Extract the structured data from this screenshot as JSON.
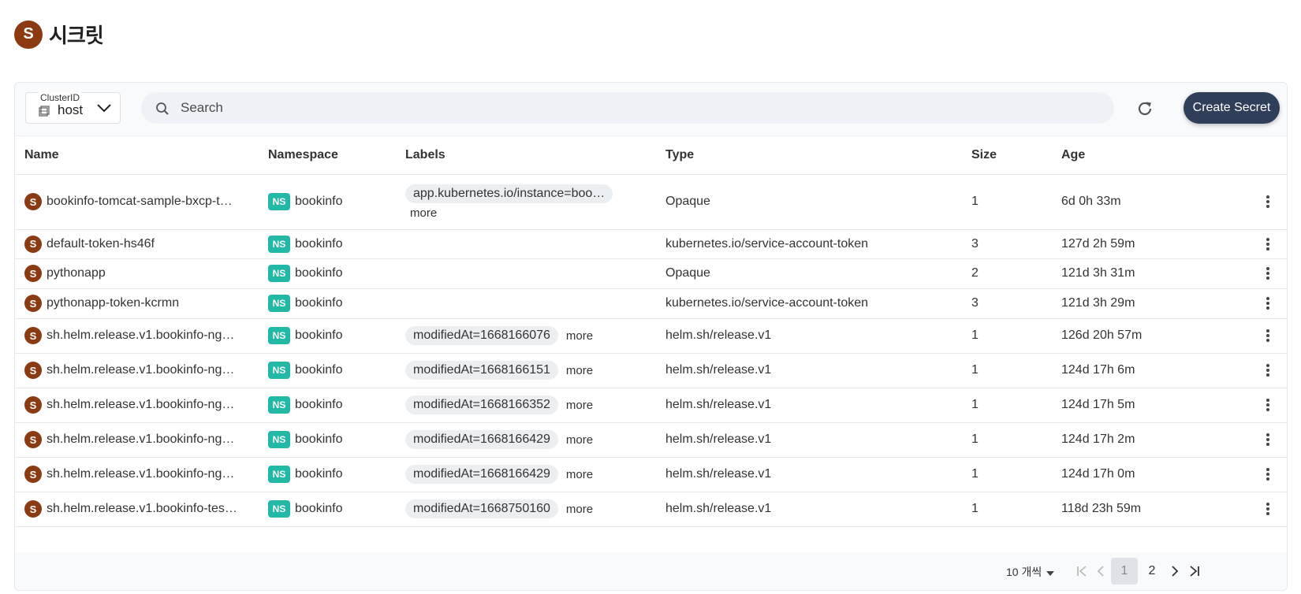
{
  "header": {
    "avatar_letter": "S",
    "title": "시크릿"
  },
  "toolbar": {
    "cluster_label": "ClusterID",
    "cluster_value": "host",
    "search_placeholder": "Search",
    "create_label": "Create Secret"
  },
  "table": {
    "columns": [
      "Name",
      "Namespace",
      "Labels",
      "Type",
      "Size",
      "Age"
    ],
    "rows": [
      {
        "avatar": "S",
        "name": "bookinfo-tomcat-sample-bxcp-t…",
        "ns_badge": "NS",
        "namespace": "bookinfo",
        "label": "app.kubernetes.io/instance=boo…",
        "more": "more",
        "type": "Opaque",
        "size": "1",
        "age": "6d 0h 33m"
      },
      {
        "avatar": "S",
        "name": "default-token-hs46f",
        "ns_badge": "NS",
        "namespace": "bookinfo",
        "label": "",
        "more": "",
        "type": "kubernetes.io/service-account-token",
        "size": "3",
        "age": "127d 2h 59m"
      },
      {
        "avatar": "S",
        "name": "pythonapp",
        "ns_badge": "NS",
        "namespace": "bookinfo",
        "label": "",
        "more": "",
        "type": "Opaque",
        "size": "2",
        "age": "121d 3h 31m"
      },
      {
        "avatar": "S",
        "name": "pythonapp-token-kcrmn",
        "ns_badge": "NS",
        "namespace": "bookinfo",
        "label": "",
        "more": "",
        "type": "kubernetes.io/service-account-token",
        "size": "3",
        "age": "121d 3h 29m"
      },
      {
        "avatar": "S",
        "name": "sh.helm.release.v1.bookinfo-ng…",
        "ns_badge": "NS",
        "namespace": "bookinfo",
        "label": "modifiedAt=1668166076",
        "more": "more",
        "type": "helm.sh/release.v1",
        "size": "1",
        "age": "126d 20h 57m"
      },
      {
        "avatar": "S",
        "name": "sh.helm.release.v1.bookinfo-ng…",
        "ns_badge": "NS",
        "namespace": "bookinfo",
        "label": "modifiedAt=1668166151",
        "more": "more",
        "type": "helm.sh/release.v1",
        "size": "1",
        "age": "124d 17h 6m"
      },
      {
        "avatar": "S",
        "name": "sh.helm.release.v1.bookinfo-ng…",
        "ns_badge": "NS",
        "namespace": "bookinfo",
        "label": "modifiedAt=1668166352",
        "more": "more",
        "type": "helm.sh/release.v1",
        "size": "1",
        "age": "124d 17h 5m"
      },
      {
        "avatar": "S",
        "name": "sh.helm.release.v1.bookinfo-ng…",
        "ns_badge": "NS",
        "namespace": "bookinfo",
        "label": "modifiedAt=1668166429",
        "more": "more",
        "type": "helm.sh/release.v1",
        "size": "1",
        "age": "124d 17h 2m"
      },
      {
        "avatar": "S",
        "name": "sh.helm.release.v1.bookinfo-ng…",
        "ns_badge": "NS",
        "namespace": "bookinfo",
        "label": "modifiedAt=1668166429",
        "more": "more",
        "type": "helm.sh/release.v1",
        "size": "1",
        "age": "124d 17h 0m"
      },
      {
        "avatar": "S",
        "name": "sh.helm.release.v1.bookinfo-tes…",
        "ns_badge": "NS",
        "namespace": "bookinfo",
        "label": "modifiedAt=1668750160",
        "more": "more",
        "type": "helm.sh/release.v1",
        "size": "1",
        "age": "118d 23h 59m"
      }
    ]
  },
  "pagination": {
    "per_page": "10 개씩",
    "pages": [
      "1",
      "2"
    ],
    "current": "1"
  },
  "colors": {
    "accent": "#8b3a12",
    "ns_badge": "#21b9a5",
    "button": "#2f3e59"
  },
  "icons": [
    "cube-icon",
    "chevron-down-icon",
    "search-icon",
    "refresh-icon",
    "kebab-icon",
    "first-page-icon",
    "prev-page-icon",
    "next-page-icon",
    "last-page-icon",
    "caret-down-icon"
  ]
}
